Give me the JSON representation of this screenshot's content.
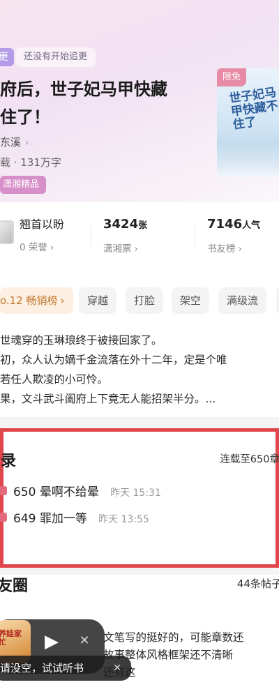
{
  "hero": {
    "update_badge": "更",
    "follow_tag": "还没有开始追更",
    "title_line1": "府后，世子妃马甲快藏",
    "title_line2": "住了！",
    "author": "东溪",
    "meta": "载 · 131万字",
    "brand_tag": "潇湘精品",
    "cover_flag": "限免",
    "cover_title": "世子妃马甲快藏不住了"
  },
  "stats": {
    "fan_name": "翘首以盼",
    "honor": "0 荣誉",
    "tickets_value": "3424",
    "tickets_unit": "张",
    "tickets_label": "潇湘票",
    "popularity_value": "7146",
    "popularity_unit": "人气",
    "popularity_label": "书友榜"
  },
  "tags": {
    "rank": "o.12 畅销榜",
    "items": [
      "穿越",
      "打脸",
      "架空",
      "满级流"
    ]
  },
  "synopsis": [
    "世魂穿的玉琳琅终于被接回家了。",
    "初，众人认为嫡千金流落在外十二年，定是个唯",
    "若任人欺凌的小可怜。",
    "果，文斗武斗阖府上下竟无人能招架半分。..."
  ],
  "catalog": {
    "title": "录",
    "status": "连载至650章",
    "chapters": [
      {
        "name": "650 晕啊不给晕",
        "time": "昨天 15:31"
      },
      {
        "name": "649 罪加一等",
        "time": "昨天 13:55"
      }
    ]
  },
  "circle": {
    "title": "友圈",
    "count": "44条帖子",
    "post_lines": [
      "文笔写的挺好的，可能章数还",
      "故事整体风格框架还不清晰",
      "还有这"
    ]
  },
  "player": {
    "cover_text": "养娃家忙",
    "hint": "请没空，试试听书"
  },
  "icons": {
    "play": "play-icon",
    "close": "close-icon",
    "chevron": "chevron-right-icon"
  },
  "colors": {
    "highlight_border": "#e0474c",
    "rank_bg": "#fdf0e2",
    "rank_text": "#c2772c",
    "brand_tag": "#d78fc9",
    "cover_flag": "#e78aa6"
  }
}
